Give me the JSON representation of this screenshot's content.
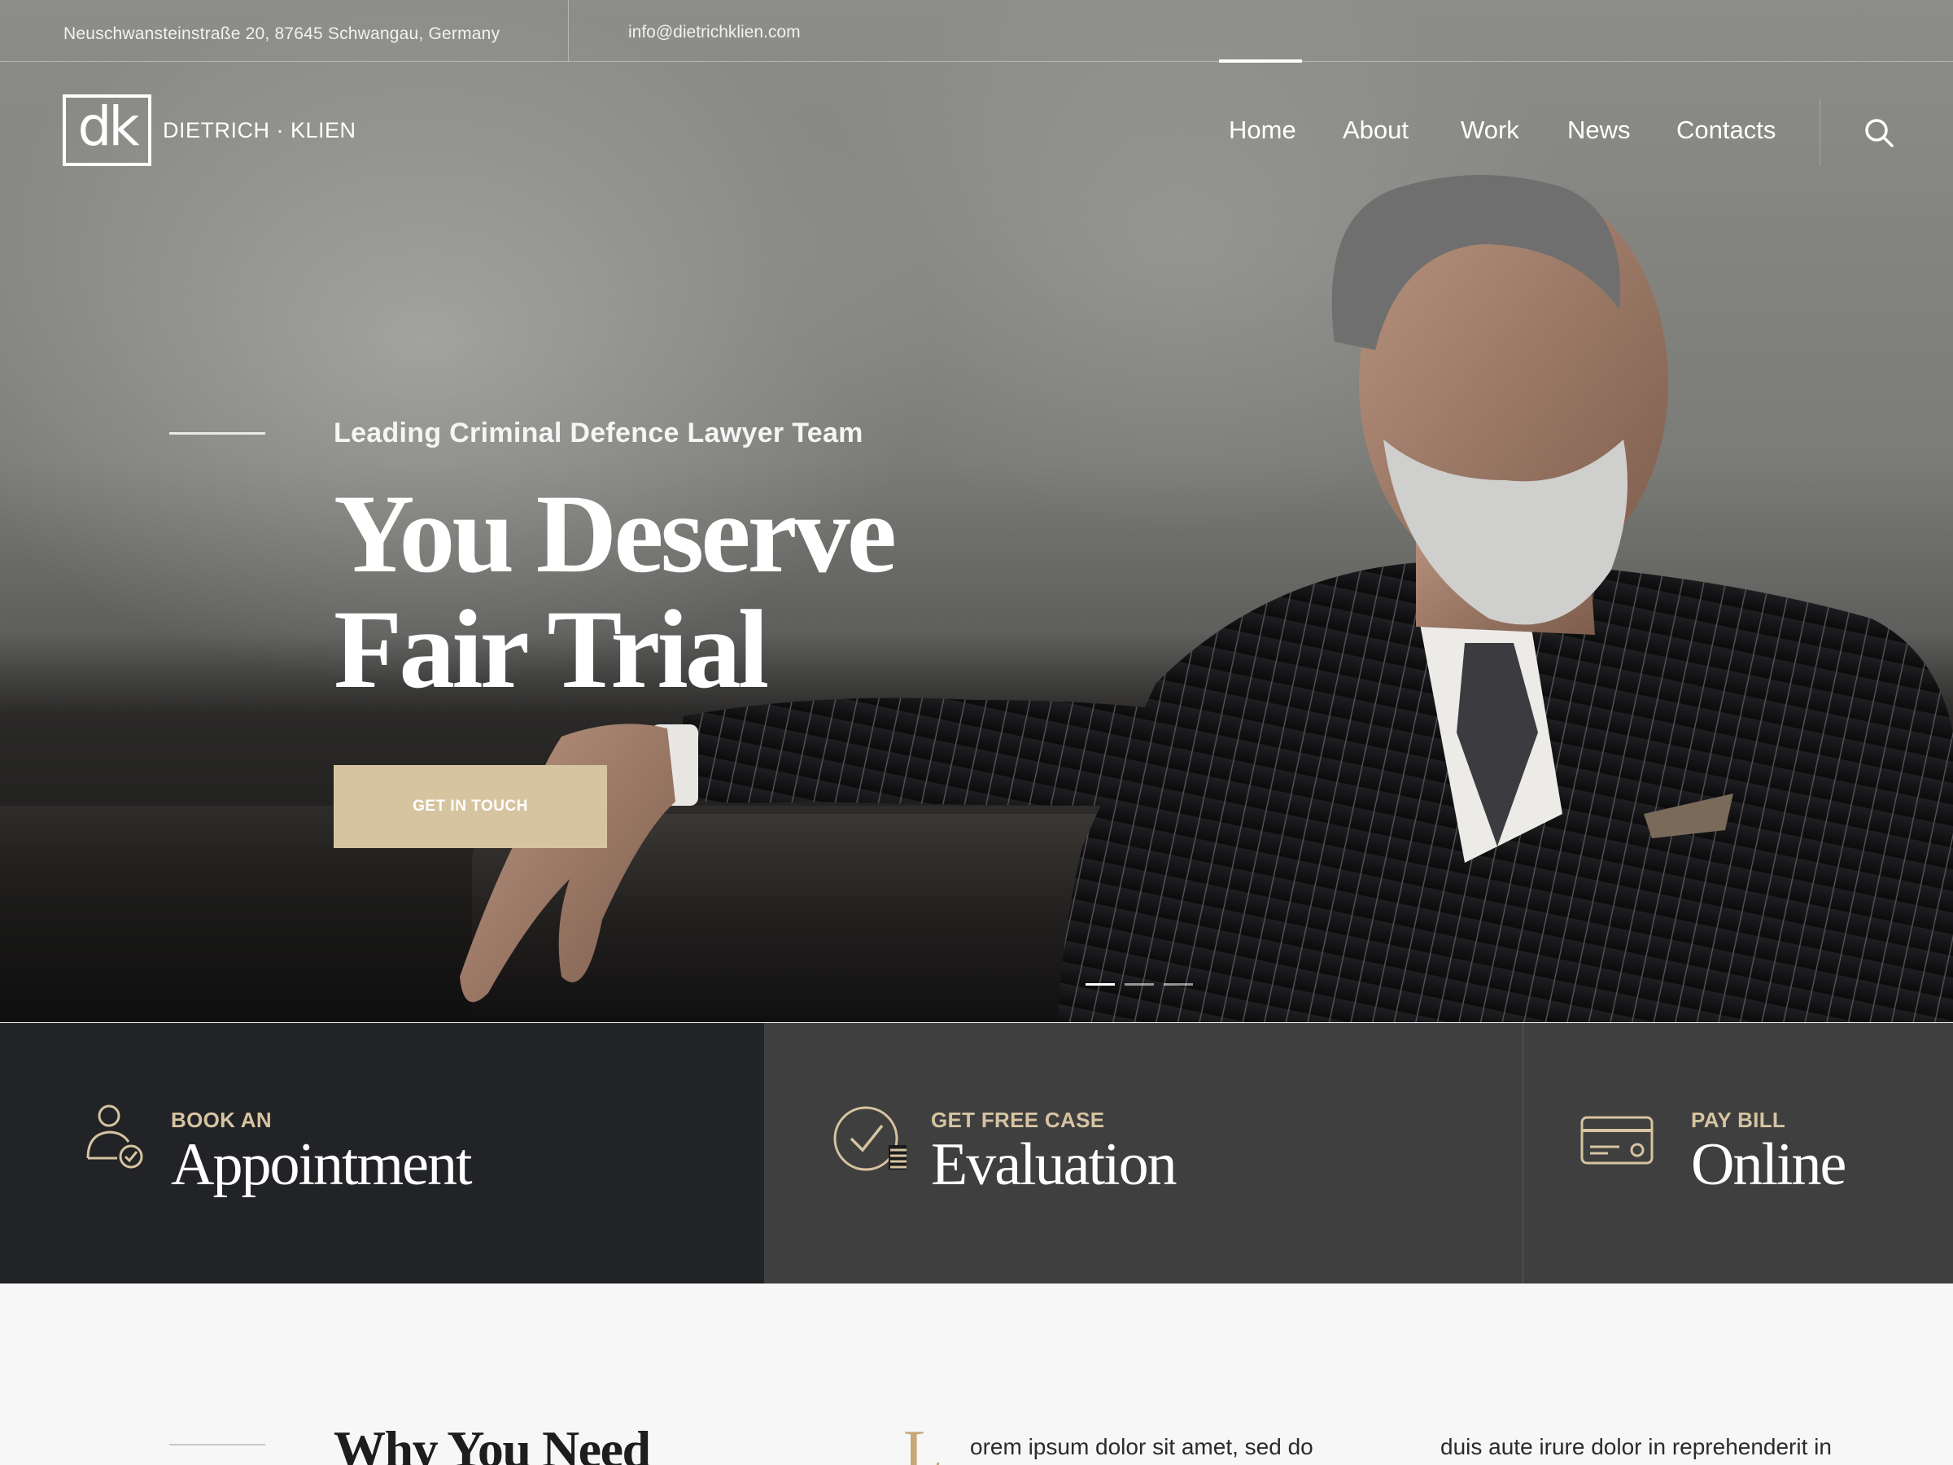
{
  "topbar": {
    "address": "Neuschwansteinstraße 20, 87645 Schwangau, Germany",
    "email": "info@dietrichklien.com"
  },
  "logo": {
    "mark": "dk",
    "name": "DIETRICH · KLIEN"
  },
  "nav": {
    "items": [
      {
        "label": "Home",
        "active": true
      },
      {
        "label": "About"
      },
      {
        "label": "Work"
      },
      {
        "label": "News"
      },
      {
        "label": "Contacts"
      }
    ],
    "search_icon": "search-icon"
  },
  "hero": {
    "subtitle": "Leading Criminal Defence Lawyer Team",
    "title_line1": "You Deserve",
    "title_line2": "Fair Trial",
    "cta_label": "GET IN TOUCH",
    "slides": {
      "count": 3,
      "active": 1
    }
  },
  "features": [
    {
      "small": "BOOK AN",
      "big": "Appointment",
      "icon": "user-check-icon"
    },
    {
      "small": "GET FREE CASE",
      "big": "Evaluation",
      "icon": "checklist-icon"
    },
    {
      "small": "PAY BILL",
      "big": "Online",
      "icon": "credit-card-icon"
    }
  ],
  "bottom": {
    "title": "Why You Need",
    "dropcap": "L",
    "col1": "orem ipsum dolor sit amet, sed do",
    "col2": "duis aute irure dolor in reprehenderit in"
  },
  "colors": {
    "accent": "#d6c4a0",
    "accent_dark": "#c6a979",
    "panel_dark": "#222326",
    "page_bg": "#f7f7f7"
  }
}
